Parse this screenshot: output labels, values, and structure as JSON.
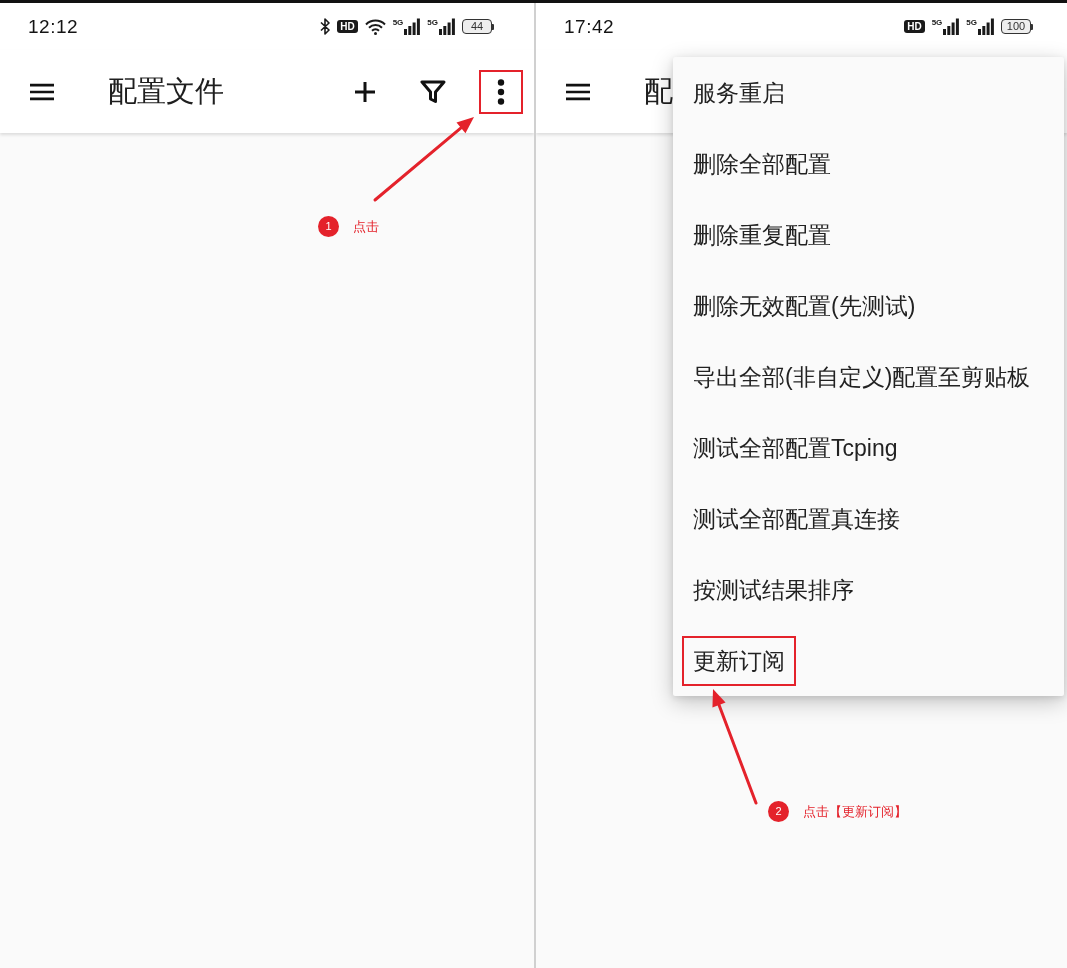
{
  "screens": [
    {
      "status_bar": {
        "time": "12:12",
        "indicators": [
          {
            "kind": "bluetooth"
          },
          {
            "kind": "hd",
            "label": "HD"
          },
          {
            "kind": "wifi"
          },
          {
            "kind": "signal",
            "label": "5G"
          },
          {
            "kind": "signal",
            "label": "5G"
          },
          {
            "kind": "battery",
            "label": "44"
          }
        ]
      },
      "app_bar": {
        "title": "配置文件",
        "actions": [
          {
            "kind": "add",
            "highlighted": false
          },
          {
            "kind": "filter",
            "highlighted": false
          },
          {
            "kind": "more",
            "highlighted": true
          }
        ]
      },
      "annotation": {
        "number": "1",
        "text": "点击"
      }
    },
    {
      "status_bar": {
        "time": "17:42",
        "indicators": [
          {
            "kind": "hd",
            "label": "HD"
          },
          {
            "kind": "signal",
            "label": "5G"
          },
          {
            "kind": "signal",
            "label": "5G"
          },
          {
            "kind": "battery",
            "label": "100"
          }
        ]
      },
      "app_bar": {
        "title": "配"
      },
      "overflow_menu": {
        "items": [
          {
            "label": "服务重启",
            "highlighted": false
          },
          {
            "label": "删除全部配置",
            "highlighted": false
          },
          {
            "label": "删除重复配置",
            "highlighted": false
          },
          {
            "label": "删除无效配置(先测试)",
            "highlighted": false
          },
          {
            "label": "导出全部(非自定义)配置至剪贴板",
            "highlighted": false
          },
          {
            "label": "测试全部配置Tcping",
            "highlighted": false
          },
          {
            "label": "测试全部配置真连接",
            "highlighted": false
          },
          {
            "label": "按测试结果排序",
            "highlighted": false
          },
          {
            "label": "更新订阅",
            "highlighted": true
          }
        ]
      },
      "annotation": {
        "number": "2",
        "text": "点击【更新订阅】"
      }
    }
  ]
}
